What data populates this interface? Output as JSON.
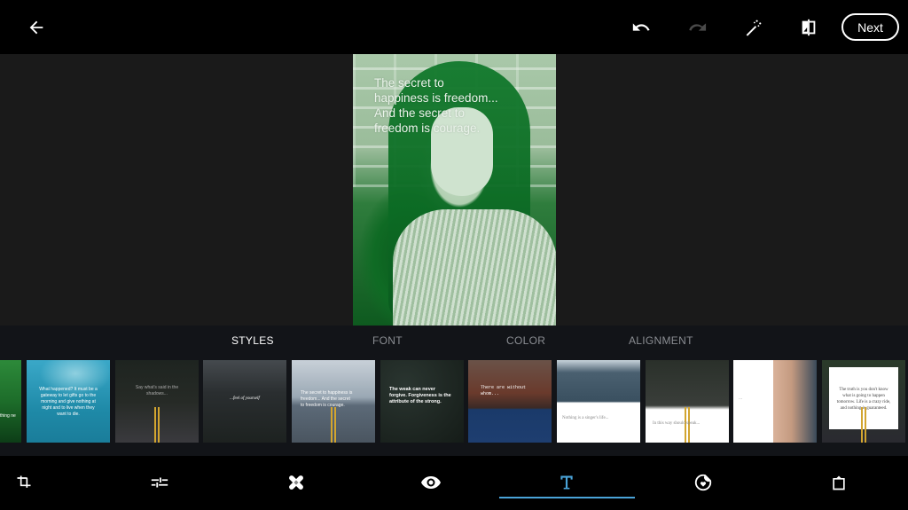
{
  "topbar": {
    "back_icon": "arrow-left-icon",
    "undo_icon": "undo-icon",
    "redo_icon": "redo-icon",
    "redo_enabled": false,
    "magic_icon": "magic-wand-icon",
    "compare_icon": "compare-icon",
    "next_label": "Next"
  },
  "canvas": {
    "quote_text": "The secret to happiness is freedom... And the secret to freedom is courage.",
    "photo_tint": "#1f7a35"
  },
  "tabs": [
    {
      "label": "STYLES",
      "active": true
    },
    {
      "label": "FONT",
      "active": false
    },
    {
      "label": "COLOR",
      "active": false
    },
    {
      "label": "ALIGNMENT",
      "active": false
    }
  ],
  "styles": [
    {
      "label": "green-leaf-style",
      "text": "thing ne"
    },
    {
      "label": "sky-style",
      "text": "What happened? It must be a gateway to let gifts go to the morning and give nothing at night and to live when they want to die."
    },
    {
      "label": "dark-road-style",
      "text": "Say what's said in the shadows..."
    },
    {
      "label": "script-storm-style",
      "text": "...feel of yourself"
    },
    {
      "label": "road-clouds-style",
      "text": "The secret to happiness is freedom... And the secret to freedom is courage."
    },
    {
      "label": "forest-bold-style",
      "text": "The weak can never forgive. Forgiveness is the attribute of the strong."
    },
    {
      "label": "mountain-lake-style",
      "text": "There are without whom..."
    },
    {
      "label": "white-box-clouds-style",
      "text": "Nothing is a singer's life..."
    },
    {
      "label": "white-box-road-style",
      "text": "In this way should speak..."
    },
    {
      "label": "portrait-style",
      "text": "..."
    },
    {
      "label": "centered-box-style",
      "text": "The truth is you don't know what is going to happen tomorrow. Life is a crazy ride, and nothing is guaranteed."
    }
  ],
  "bottom_nav": [
    {
      "name": "crop",
      "icon": "crop-icon",
      "active": false
    },
    {
      "name": "adjust",
      "icon": "sliders-icon",
      "active": false
    },
    {
      "name": "healing",
      "icon": "bandage-icon",
      "active": false
    },
    {
      "name": "red-eye",
      "icon": "eye-icon",
      "active": false
    },
    {
      "name": "text",
      "icon": "text-icon",
      "active": true
    },
    {
      "name": "sticker",
      "icon": "sticker-icon",
      "active": false
    },
    {
      "name": "frame",
      "icon": "frame-icon",
      "active": false
    }
  ],
  "colors": {
    "accent": "#4aa3d8",
    "panel_bg": "#121418",
    "canvas_bg": "#1a1a1a"
  }
}
